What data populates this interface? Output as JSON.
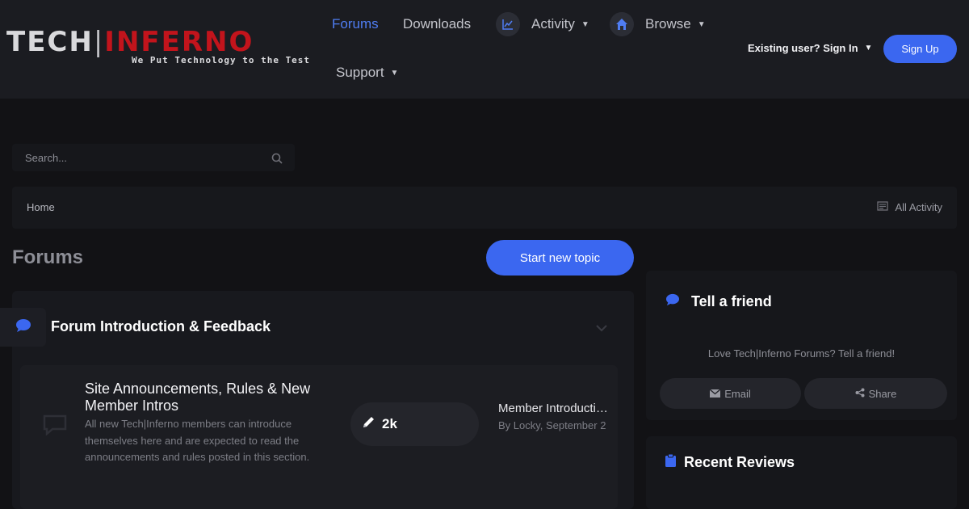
{
  "brand": {
    "logo_tech": "TECH",
    "logo_sep": "|",
    "logo_inferno": "INFERNO",
    "tagline": "We Put Technology to the Test",
    "colors": {
      "accent": "#3b67f0",
      "link_active": "#4f7df3",
      "logo_red": "#c2141c"
    }
  },
  "nav": {
    "forums": "Forums",
    "downloads": "Downloads",
    "activity": "Activity",
    "browse": "Browse",
    "support": "Support",
    "icons": {
      "activity": "line-chart-icon",
      "browse": "home-icon"
    }
  },
  "user": {
    "signin": "Existing user? Sign In",
    "signup": "Sign Up"
  },
  "search": {
    "placeholder": "Search..."
  },
  "breadcrumb": {
    "home": "Home",
    "all_activity": "All Activity"
  },
  "page": {
    "title": "Forums",
    "start_topic": "Start new topic"
  },
  "category": {
    "title": "Forum Introduction & Feedback",
    "forum": {
      "name": "Site Announcements, Rules & New Member Intros",
      "description": "All new Tech|Inferno members can introduce themselves here and are expected to read the announcements and rules posted in this section.",
      "post_count": "2k",
      "last_post_title": "Member Introductions",
      "last_post_by": "By Locky, September 2"
    }
  },
  "sidebar": {
    "tell_friend": {
      "title": "Tell a friend",
      "text": "Love Tech|Inferno Forums? Tell a friend!",
      "email": "Email",
      "share": "Share"
    },
    "recent_reviews": {
      "title": "Recent Reviews"
    }
  }
}
